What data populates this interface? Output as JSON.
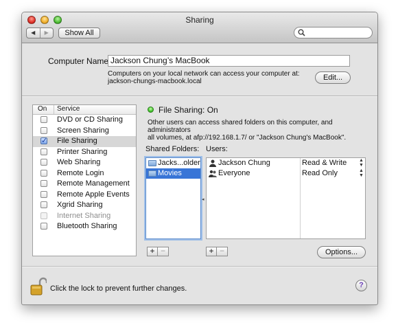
{
  "window": {
    "title": "Sharing"
  },
  "toolbar": {
    "back_glyph": "◀",
    "forward_glyph": "▶",
    "show_all_label": "Show All",
    "search_placeholder": ""
  },
  "computer": {
    "label": "Computer Name:",
    "name": "Jackson Chung’s MacBook",
    "desc_line1": "Computers on your local network can access your computer at:",
    "desc_line2": "jackson-chungs-macbook.local",
    "edit_label": "Edit..."
  },
  "services": {
    "col_on": "On",
    "col_service": "Service",
    "items": [
      {
        "name": "DVD or CD Sharing",
        "checked": false,
        "enabled": true,
        "selected": false
      },
      {
        "name": "Screen Sharing",
        "checked": false,
        "enabled": true,
        "selected": false
      },
      {
        "name": "File Sharing",
        "checked": true,
        "enabled": true,
        "selected": true
      },
      {
        "name": "Printer Sharing",
        "checked": false,
        "enabled": true,
        "selected": false
      },
      {
        "name": "Web Sharing",
        "checked": false,
        "enabled": true,
        "selected": false
      },
      {
        "name": "Remote Login",
        "checked": false,
        "enabled": true,
        "selected": false
      },
      {
        "name": "Remote Management",
        "checked": false,
        "enabled": true,
        "selected": false
      },
      {
        "name": "Remote Apple Events",
        "checked": false,
        "enabled": true,
        "selected": false
      },
      {
        "name": "Xgrid Sharing",
        "checked": false,
        "enabled": true,
        "selected": false
      },
      {
        "name": "Internet Sharing",
        "checked": false,
        "enabled": false,
        "selected": false
      },
      {
        "name": "Bluetooth Sharing",
        "checked": false,
        "enabled": true,
        "selected": false
      }
    ]
  },
  "status": {
    "text": "File Sharing: On",
    "color": "#42c52b",
    "info_line1": "Other users can access shared folders on this computer, and administrators",
    "info_line2": "all volumes, at afp://192.168.1.7/ or \"Jackson Chung's MacBook\"."
  },
  "shared_folders": {
    "label": "Shared Folders:",
    "items": [
      {
        "name": "Jacks...older",
        "selected": false
      },
      {
        "name": "Movies",
        "selected": true
      }
    ]
  },
  "users": {
    "label": "Users:",
    "items": [
      {
        "name": "Jackson Chung",
        "icon": "user-icon",
        "permission": "Read & Write"
      },
      {
        "name": "Everyone",
        "icon": "group-icon",
        "permission": "Read Only"
      }
    ]
  },
  "buttons": {
    "plus": "+",
    "minus": "−",
    "options_label": "Options..."
  },
  "footer": {
    "lock_text": "Click the lock to prevent further changes.",
    "help_glyph": "?"
  }
}
